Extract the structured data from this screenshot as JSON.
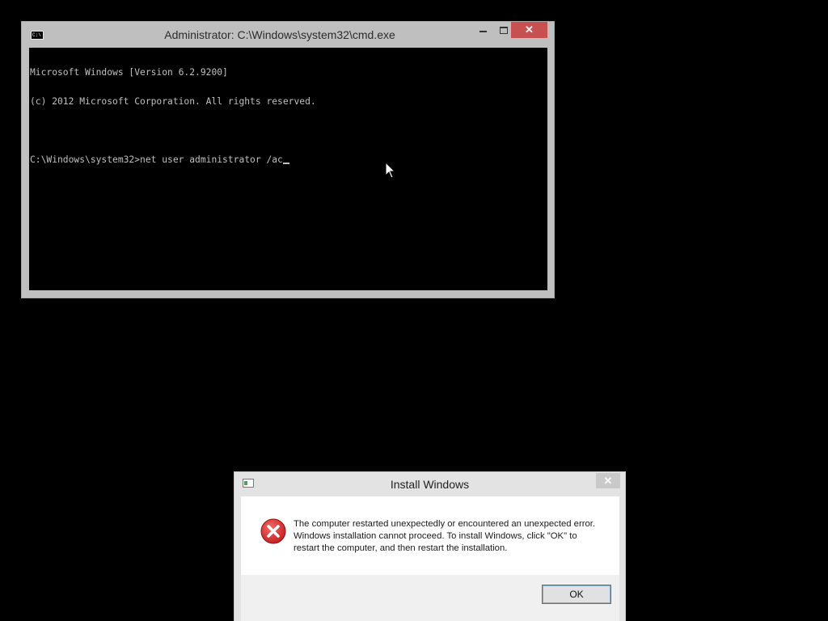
{
  "cmd": {
    "app_icon_text": "C:\\",
    "title": "Administrator: C:\\Windows\\system32\\cmd.exe",
    "close_glyph": "✕",
    "console_lines": [
      "Microsoft Windows [Version 6.2.9200]",
      "(c) 2012 Microsoft Corporation. All rights reserved.",
      "",
      "C:\\Windows\\system32>net user administrator /ac"
    ]
  },
  "dialog": {
    "title": "Install Windows",
    "close_glyph": "✕",
    "message": "The computer restarted unexpectedly or encountered an unexpected error. Windows installation cannot proceed. To install Windows, click \"OK\" to restart the computer, and then restart the installation.",
    "ok_label": "OK"
  },
  "colors": {
    "desktop": "#000000",
    "cmd_close_red": "#c75050",
    "error_red": "#d92b2b"
  },
  "icons": {
    "cmd_app": "console-icon",
    "dialog_app": "setup-window-icon",
    "error": "error-x-icon",
    "pointer": "mouse-arrow-icon"
  }
}
